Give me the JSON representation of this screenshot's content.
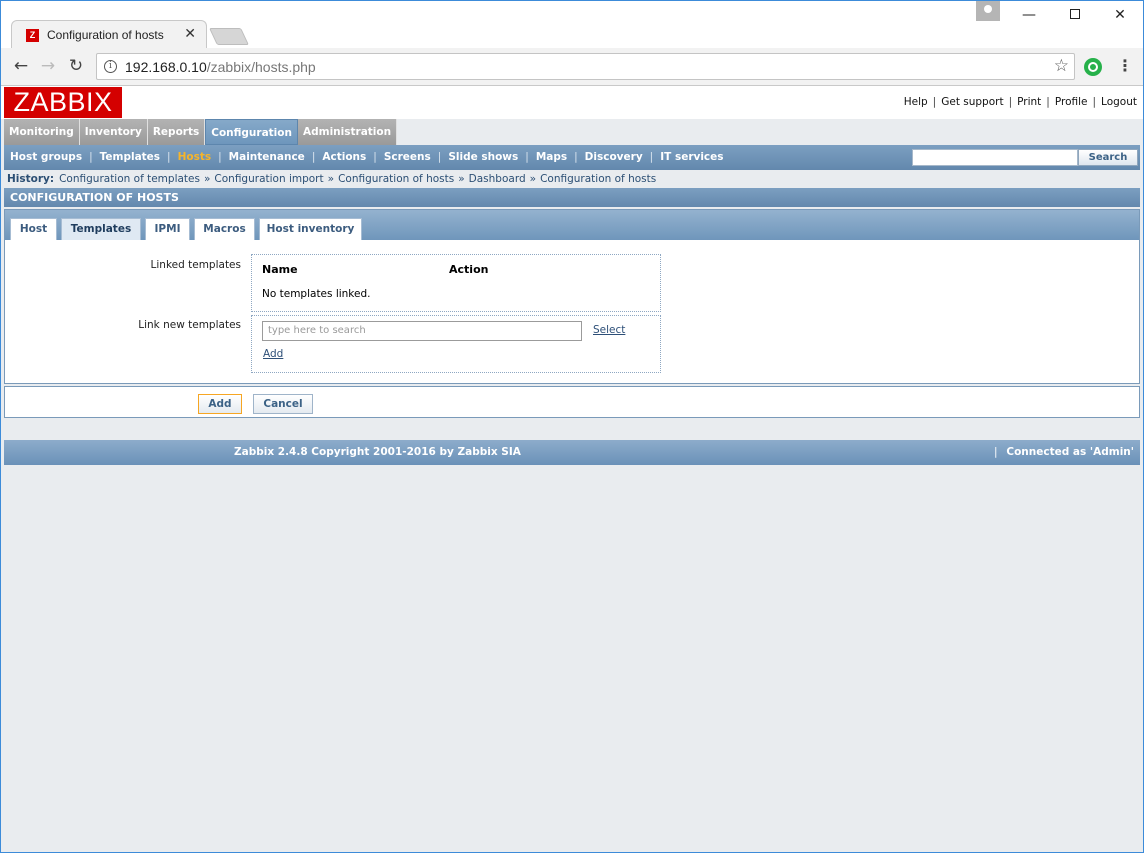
{
  "browser": {
    "tab_title": "Configuration of hosts",
    "tab_favicon": "Z",
    "url_host": "192.168.0.10",
    "url_path": "/zabbix/hosts.php"
  },
  "header": {
    "logo": "ZABBIX",
    "links": [
      "Help",
      "Get support",
      "Print",
      "Profile",
      "Logout"
    ]
  },
  "main_menu": [
    "Monitoring",
    "Inventory",
    "Reports",
    "Configuration",
    "Administration"
  ],
  "main_menu_selected": "Configuration",
  "sub_menu": [
    "Host groups",
    "Templates",
    "Hosts",
    "Maintenance",
    "Actions",
    "Screens",
    "Slide shows",
    "Maps",
    "Discovery",
    "IT services"
  ],
  "sub_menu_active": "Hosts",
  "search": {
    "button": "Search",
    "value": ""
  },
  "history": {
    "label": "History:",
    "items": [
      "Configuration of templates",
      "Configuration import",
      "Configuration of hosts",
      "Dashboard",
      "Configuration of hosts"
    ]
  },
  "section_title": "CONFIGURATION OF HOSTS",
  "tabs": [
    "Host",
    "Templates",
    "IPMI",
    "Macros",
    "Host inventory"
  ],
  "active_tab": "Templates",
  "form": {
    "linked_label": "Linked templates",
    "col_name": "Name",
    "col_action": "Action",
    "empty_text": "No templates linked.",
    "link_new_label": "Link new templates",
    "search_placeholder": "type here to search",
    "select_link": "Select",
    "add_link": "Add"
  },
  "buttons": {
    "add": "Add",
    "cancel": "Cancel"
  },
  "footer": {
    "copyright": "Zabbix 2.4.8 Copyright 2001-2016 by Zabbix SIA",
    "separator": "|",
    "connected": "Connected as 'Admin'"
  },
  "colors": {
    "accent": "#d40000",
    "menu_blue": "#6388ad",
    "active_link": "#f6b52b"
  }
}
